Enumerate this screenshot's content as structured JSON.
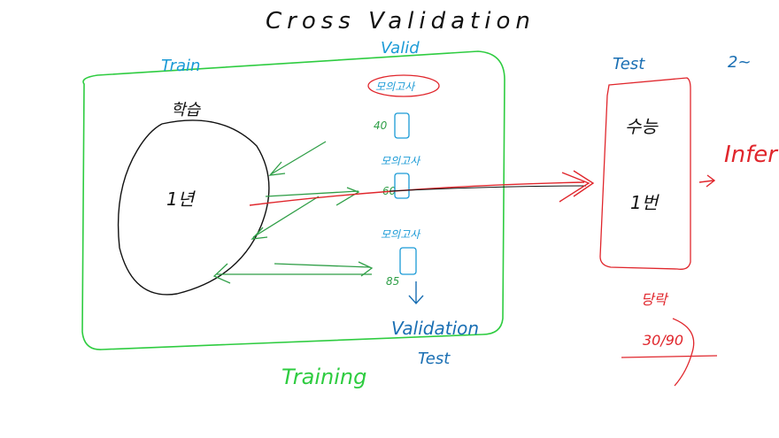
{
  "title": "Cross Validation",
  "train_box": {
    "label": "Train",
    "top_label": "학습",
    "circle_label": "1년",
    "bottom_label": "Training",
    "color": "#2ecc40"
  },
  "validation": {
    "label": "Valid",
    "items": [
      {
        "tag": "모의고사",
        "score": "40"
      },
      {
        "tag": "모의고사",
        "score": "60"
      },
      {
        "tag": "모의고사",
        "score": "85"
      }
    ],
    "footer_1": "Validation",
    "footer_2": "Test",
    "color": "#1f77b4"
  },
  "test_box": {
    "label": "Test",
    "label_side": "2~",
    "exam": "수능",
    "exam_value": "1번",
    "color": "#e8383d"
  },
  "inference": {
    "label": "Infer",
    "note": "당락",
    "score": "30/90"
  },
  "colors": {
    "ink": "#111111",
    "green": "#2fbf3a",
    "green_dark": "#2e9e46",
    "blue": "#1a6fb3",
    "cyan": "#1a9ad6",
    "red": "#e0262c"
  }
}
